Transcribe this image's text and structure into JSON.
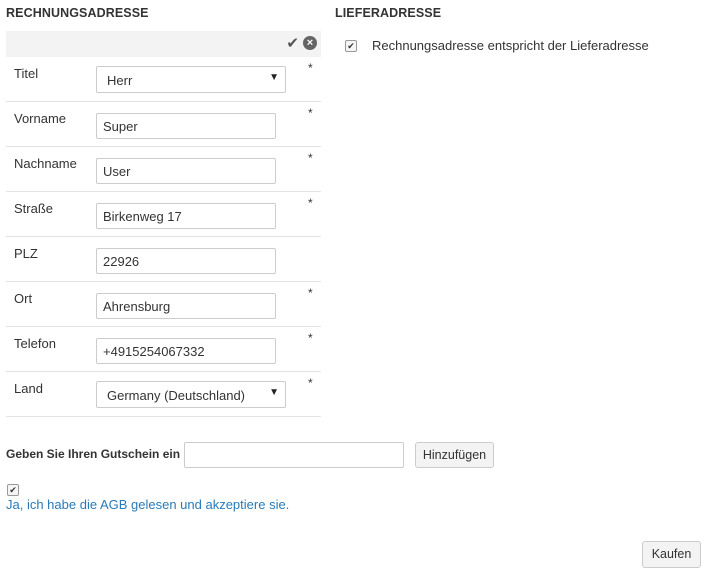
{
  "billing": {
    "title": "RECHNUNGSADRESSE",
    "confirm_icon": "check-icon",
    "cancel_icon": "close-circle-icon",
    "fields": [
      {
        "label": "Titel",
        "value": "Herr",
        "type": "select",
        "required": "*"
      },
      {
        "label": "Vorname",
        "value": "Super",
        "type": "text",
        "required": "*"
      },
      {
        "label": "Nachname",
        "value": "User",
        "type": "text",
        "required": "*"
      },
      {
        "label": "Straße",
        "value": "Birkenweg 17",
        "type": "text",
        "required": "*"
      },
      {
        "label": "PLZ",
        "value": "22926",
        "type": "text",
        "required": ""
      },
      {
        "label": "Ort",
        "value": "Ahrensburg",
        "type": "text",
        "required": "*"
      },
      {
        "label": "Telefon",
        "value": "+4915254067332",
        "type": "text",
        "required": "*"
      },
      {
        "label": "Land",
        "value": "Germany (Deutschland)",
        "type": "select",
        "required": "*"
      }
    ]
  },
  "shipping": {
    "title": "LIEFERADRESSE",
    "same_as_billing_label": "Rechnungsadresse entspricht der Lieferadresse",
    "same_as_billing_checked": true
  },
  "coupon": {
    "label": "Geben Sie Ihren Gutschein ein",
    "value": "",
    "add_button": "Hinzufügen"
  },
  "terms": {
    "checked": true,
    "label": "Ja, ich habe die AGB gelesen und akzeptiere sie."
  },
  "buy_button": "Kaufen",
  "colors": {
    "link": "#2a7ab8",
    "border": "#cccccc",
    "panel_header_bg": "#f3f3f3"
  }
}
